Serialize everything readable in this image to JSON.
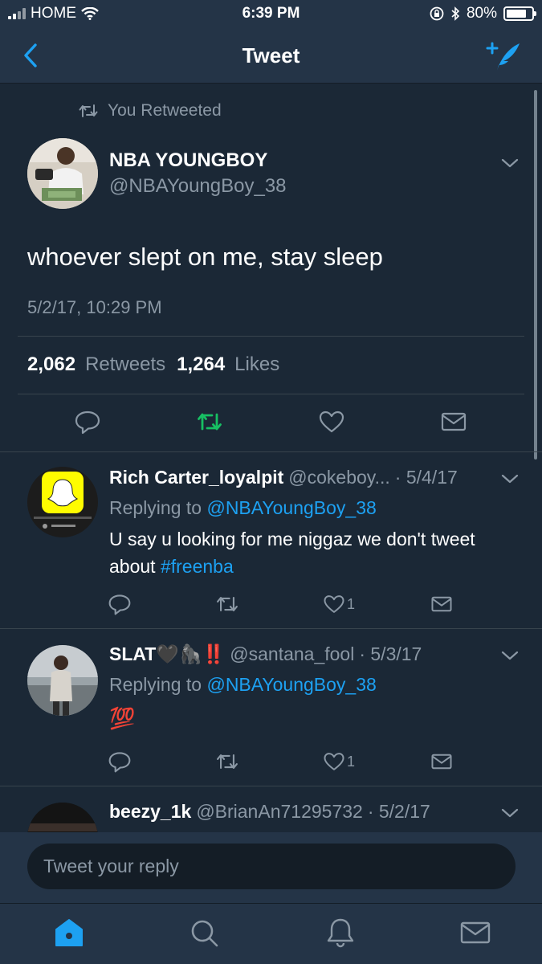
{
  "status_bar": {
    "carrier": "HOME",
    "time": "6:39 PM",
    "battery": "80%",
    "battery_level": 0.8
  },
  "nav": {
    "title": "Tweet"
  },
  "main_tweet": {
    "retweet_context": "You Retweeted",
    "name": "NBA YOUNGBOY",
    "handle": "@NBAYoungBoy_38",
    "text": "whoever slept on me, stay sleep",
    "date": "5/2/17, 10:29 PM",
    "retweets_count": "2,062",
    "retweets_label": "Retweets",
    "likes_count": "1,264",
    "likes_label": "Likes"
  },
  "replies": [
    {
      "name": "Rich Carter_loyalpit",
      "handle": "@cokeboy...",
      "date": "· 5/4/17",
      "replying_prefix": "Replying to",
      "replying_to": "@NBAYoungBoy_38",
      "text": "U say u looking for me niggaz we don't tweet about",
      "hashtag": "#freenba",
      "likes": "1"
    },
    {
      "name": "SLAT🖤🦍‼️",
      "handle": "@santana_fool",
      "date": "· 5/3/17",
      "replying_prefix": "Replying to",
      "replying_to": "@NBAYoungBoy_38",
      "text": "💯",
      "likes": "1"
    },
    {
      "name": "beezy_1k",
      "handle": "@BrianAn71295732",
      "date": "· 5/2/17"
    }
  ],
  "reply_input": {
    "placeholder": "Tweet your reply"
  },
  "colors": {
    "background": "#1b2836",
    "bar": "#243447",
    "accent": "#1da1f2",
    "retweet_green": "#17bf63",
    "secondary_text": "#8b98a5"
  },
  "icons": [
    "back-icon",
    "compose-icon",
    "retweet-icon",
    "reply-icon",
    "heart-icon",
    "dm-icon",
    "home-icon",
    "search-icon",
    "bell-icon",
    "mail-icon"
  ]
}
